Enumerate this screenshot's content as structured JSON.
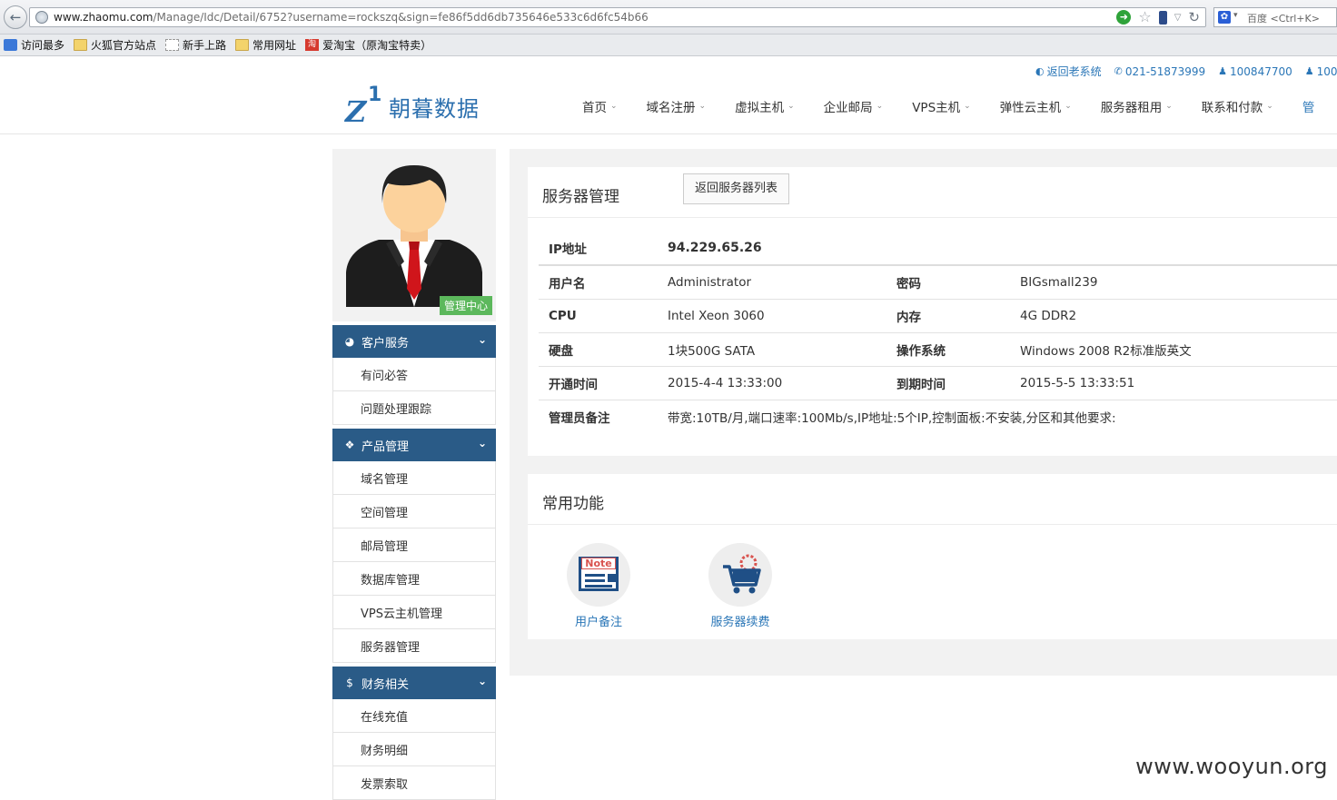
{
  "browser": {
    "url_host": "www.zhaomu.com",
    "url_path": "/Manage/Idc/Detail/6752?username=rockszq&sign=fe86f5dd6db735646e533c6d6fc54b66",
    "search_placeholder": "百度 <Ctrl+K>",
    "bookmarks": [
      "访问最多",
      "火狐官方站点",
      "新手上路",
      "常用网址",
      "爱淘宝（原淘宝特卖）"
    ]
  },
  "topinfo": {
    "old_system": "返回老系统",
    "phone": "021-51873999",
    "qq1": "100847700",
    "qq2": "100"
  },
  "logo": {
    "mark_letter": "Z",
    "mark_digit": "1",
    "text": "朝暮数据"
  },
  "nav": [
    "首页",
    "域名注册",
    "虚拟主机",
    "企业邮局",
    "VPS主机",
    "弹性云主机",
    "服务器租用",
    "联系和付款",
    "管"
  ],
  "sidebar": {
    "badge": "管理中心",
    "groups": [
      {
        "title": "客户服务",
        "icon": "dashboard-icon",
        "items": [
          "有问必答",
          "问题处理跟踪"
        ]
      },
      {
        "title": "产品管理",
        "icon": "cubes-icon",
        "items": [
          "域名管理",
          "空间管理",
          "邮局管理",
          "数据库管理",
          "VPS云主机管理",
          "服务器管理"
        ]
      },
      {
        "title": "财务相关",
        "icon": "dollar-icon",
        "items": [
          "在线充值",
          "财务明细",
          "发票索取"
        ]
      }
    ]
  },
  "server": {
    "title": "服务器管理",
    "back_button": "返回服务器列表",
    "ip_label": "IP地址",
    "ip": "94.229.65.26",
    "user_label": "用户名",
    "user": "Administrator",
    "pass_label": "密码",
    "pass": "BIGsmall239",
    "cpu_label": "CPU",
    "cpu": "Intel Xeon 3060",
    "mem_label": "内存",
    "mem": "4G DDR2",
    "disk_label": "硬盘",
    "disk": "1块500G SATA",
    "os_label": "操作系统",
    "os": "Windows 2008 R2标准版英文",
    "open_label": "开通时间",
    "open": "2015-4-4 13:33:00",
    "expire_label": "到期时间",
    "expire": "2015-5-5 13:33:51",
    "note_label": "管理员备注",
    "note": "带宽:10TB/月,端口速率:100Mb/s,IP地址:5个IP,控制面板:不安装,分区和其他要求:"
  },
  "functions": {
    "title": "常用功能",
    "note_tag": "Note",
    "items": [
      "用户备注",
      "服务器续费"
    ]
  },
  "watermark": "www.wooyun.org"
}
